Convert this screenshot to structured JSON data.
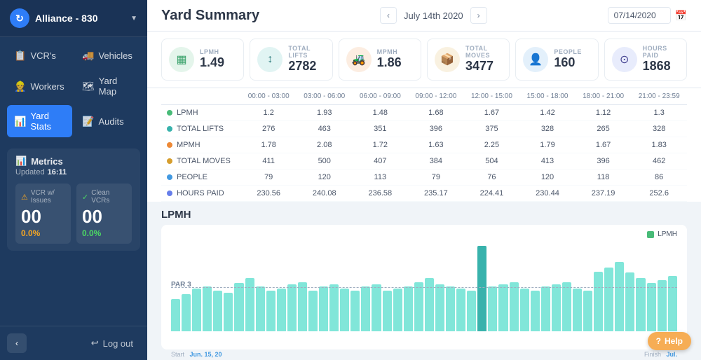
{
  "sidebar": {
    "title": "Alliance - 830",
    "logo_char": "↻",
    "nav_items": [
      {
        "id": "vcrs",
        "label": "VCR's",
        "icon": "📋"
      },
      {
        "id": "vehicles",
        "label": "Vehicles",
        "icon": "🚚"
      },
      {
        "id": "workers",
        "label": "Workers",
        "icon": "👷"
      },
      {
        "id": "yard_map",
        "label": "Yard Map",
        "icon": "🗺"
      },
      {
        "id": "yard_stats",
        "label": "Yard Stats",
        "icon": "📊",
        "active": true
      },
      {
        "id": "audits",
        "label": "Audits",
        "icon": "📝"
      }
    ],
    "metrics_label": "Metrics",
    "updated_label": "Updated",
    "updated_time": "16:11",
    "vcr_issues_label": "VCR w/ Issues",
    "clean_vcrs_label": "Clean VCRs",
    "vcr_issues_value": "00",
    "clean_vcrs_value": "00",
    "vcr_issues_pct": "0.0%",
    "clean_vcrs_pct": "0.0%",
    "logout_label": "Log out"
  },
  "header": {
    "title": "Yard Summary",
    "date_label": "July 14th 2020",
    "date_input": "07/14/2020"
  },
  "summary_cards": [
    {
      "label": "LPMH",
      "value": "1.49",
      "icon": "▦",
      "icon_class": "card-icon-green"
    },
    {
      "label": "TOTAL LIFTS",
      "value": "2782",
      "icon": "↕",
      "icon_class": "card-icon-teal"
    },
    {
      "label": "MPMH",
      "value": "1.86",
      "icon": "🚜",
      "icon_class": "card-icon-orange"
    },
    {
      "label": "TOTAL MOVES",
      "value": "3477",
      "icon": "📦",
      "icon_class": "card-icon-amber"
    },
    {
      "label": "PEOPLE",
      "value": "160",
      "icon": "👤",
      "icon_class": "card-icon-blue"
    },
    {
      "label": "HOURS PAID",
      "value": "1868",
      "icon": "⊙",
      "icon_class": "card-icon-indigo"
    }
  ],
  "table": {
    "columns": [
      "",
      "00:00 - 03:00",
      "03:00 - 06:00",
      "06:00 - 09:00",
      "09:00 - 12:00",
      "12:00 - 15:00",
      "15:00 - 18:00",
      "18:00 - 21:00",
      "21:00 - 23:59"
    ],
    "rows": [
      {
        "label": "LPMH",
        "dot": "dot-green",
        "values": [
          "1.2",
          "1.93",
          "1.48",
          "1.68",
          "1.67",
          "1.42",
          "1.12",
          "1.3"
        ]
      },
      {
        "label": "TOTAL LIFTS",
        "dot": "dot-teal",
        "values": [
          "276",
          "463",
          "351",
          "396",
          "375",
          "328",
          "265",
          "328"
        ]
      },
      {
        "label": "MPMH",
        "dot": "dot-orange",
        "values": [
          "1.78",
          "2.08",
          "1.72",
          "1.63",
          "2.25",
          "1.79",
          "1.67",
          "1.83"
        ]
      },
      {
        "label": "TOTAL MOVES",
        "dot": "dot-amber",
        "values": [
          "411",
          "500",
          "407",
          "384",
          "504",
          "413",
          "396",
          "462"
        ]
      },
      {
        "label": "PEOPLE",
        "dot": "dot-blue",
        "values": [
          "79",
          "120",
          "113",
          "79",
          "76",
          "120",
          "118",
          "86"
        ]
      },
      {
        "label": "HOURS PAID",
        "dot": "dot-indigo",
        "values": [
          "230.56",
          "240.08",
          "236.58",
          "235.17",
          "224.41",
          "230.44",
          "237.19",
          "252.6"
        ]
      }
    ]
  },
  "chart": {
    "title": "LPMH",
    "legend_label": "LPMH",
    "par_label": "PAR 3",
    "x_start": "Start",
    "x_start_date": "Jun. 15, 20",
    "x_end": "Finish",
    "x_end_date": "Jul.",
    "bars": [
      30,
      35,
      40,
      42,
      38,
      36,
      45,
      50,
      42,
      38,
      40,
      44,
      46,
      38,
      42,
      44,
      40,
      38,
      42,
      44,
      38,
      40,
      42,
      46,
      50,
      44,
      42,
      40,
      38,
      80,
      42,
      44,
      46,
      40,
      38,
      42,
      44,
      46,
      40,
      38,
      56,
      60,
      65,
      55,
      50,
      45,
      48,
      52
    ]
  },
  "help": {
    "label": "Help"
  }
}
